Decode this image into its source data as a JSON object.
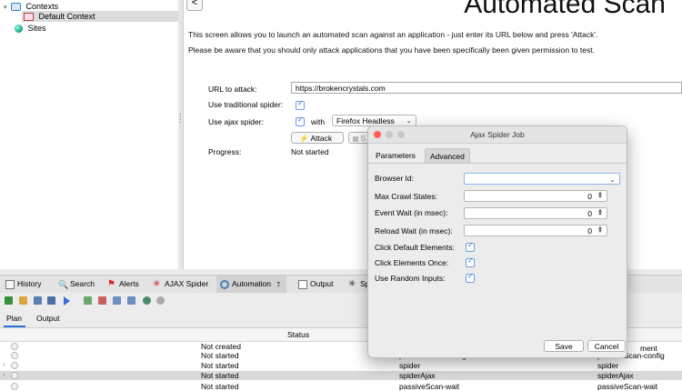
{
  "tree": {
    "items": [
      {
        "label": "Contexts"
      },
      {
        "label": "Default Context"
      },
      {
        "label": "Sites"
      }
    ]
  },
  "quick_start": {
    "back_label": "<",
    "title": "Automated Scan",
    "intro": "This screen allows you to launch an automated scan against  an application - just enter its URL below and press 'Attack'.",
    "warning": "Please be aware that you should only attack applications that you have been specifically been given permission to test.",
    "url_label": "URL to attack:",
    "url_value": "https://brokencrystals.com",
    "traditional_label": "Use traditional spider:",
    "ajax_label": "Use ajax spider:",
    "with_label": "with",
    "browser_value": "Firefox Headless",
    "attack_label": "Attack",
    "stop_label": "S",
    "progress_label": "Progress:",
    "progress_value": "Not started"
  },
  "bottom_tabs": [
    {
      "label": "History"
    },
    {
      "label": "Search"
    },
    {
      "label": "Alerts"
    },
    {
      "label": "AJAX Spider"
    },
    {
      "label": "Automation"
    },
    {
      "label": "Output"
    },
    {
      "label": "Sp"
    }
  ],
  "sub_tabs": [
    {
      "label": "Plan"
    },
    {
      "label": "Output"
    }
  ],
  "table": {
    "columns": {
      "status": "Status",
      "type": "ment"
    },
    "rows": [
      {
        "status": "Not created",
        "name": "",
        "type": ""
      },
      {
        "status": "Not started",
        "name": "passiveScan-config",
        "type": "passiveScan-config"
      },
      {
        "status": "Not started",
        "name": "spider",
        "type": "spider"
      },
      {
        "status": "Not started",
        "name": "spiderAjax",
        "type": "spiderAjax"
      },
      {
        "status": "Not started",
        "name": "passiveScan-wait",
        "type": "passiveScan-wait"
      }
    ]
  },
  "dialog": {
    "title": "Ajax Spider Job",
    "tabs": [
      {
        "label": "Parameters"
      },
      {
        "label": "Advanced"
      }
    ],
    "fields": {
      "browser_id": {
        "label": "Browser Id:",
        "value": ""
      },
      "max_crawl_states": {
        "label": "Max Crawl States:",
        "value": "0"
      },
      "event_wait": {
        "label": "Event Wait (in msec):",
        "value": "0"
      },
      "reload_wait": {
        "label": "Reload Wait (in msec):",
        "value": "0"
      },
      "click_default": {
        "label": "Click Default Elements:"
      },
      "click_once": {
        "label": "Click Elements Once:"
      },
      "random_inputs": {
        "label": "Use Random Inputs:"
      }
    },
    "save_label": "Save",
    "cancel_label": "Cancel"
  },
  "colors": {
    "accent": "#2f6fd6",
    "selected_row": "#d9d9d9"
  }
}
